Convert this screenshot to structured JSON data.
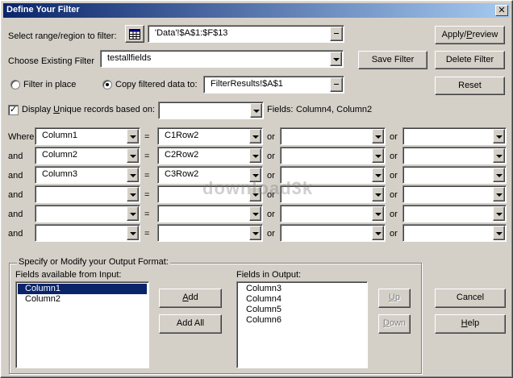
{
  "title": "Define Your Filter",
  "close_glyph": "✕",
  "select_range": {
    "label": "Select range/region to filter:",
    "value": "'Data'!$A$1:$F$13"
  },
  "existing_filter": {
    "label": "Choose Existing Filter",
    "value": "testallfields"
  },
  "filter_in_place": {
    "label": "Filter in place",
    "selected": false
  },
  "copy_to": {
    "label": "Copy filtered data to:",
    "selected": true,
    "value": "FilterResults!$A$1"
  },
  "unique": {
    "label_pre": "Display ",
    "label_u": "U",
    "label_post": "nique records based on:",
    "checked": true,
    "value": "",
    "fields_label": "Fields:",
    "fields_value": "Column4, Column2"
  },
  "buttons": {
    "apply_pre": "Apply/",
    "apply_u": "P",
    "apply_post": "review",
    "save": "Save Filter",
    "delete": "Delete Filter",
    "reset": "Reset",
    "add_u": "A",
    "add_post": "dd",
    "addall": "Add All",
    "up_u": "U",
    "up_post": "p",
    "down_u": "D",
    "down_post": "own",
    "cancel": "Cancel",
    "help_u": "H",
    "help_post": "elp"
  },
  "criteria": {
    "eq": "=",
    "or": "or",
    "rows": [
      {
        "conj": "Where",
        "field": "Column1",
        "val1": "C1Row2",
        "val2": "",
        "val3": ""
      },
      {
        "conj": "and",
        "field": "Column2",
        "val1": "C2Row2",
        "val2": "",
        "val3": ""
      },
      {
        "conj": "and",
        "field": "Column3",
        "val1": "C3Row2",
        "val2": "",
        "val3": ""
      },
      {
        "conj": "and",
        "field": "",
        "val1": "",
        "val2": "",
        "val3": ""
      },
      {
        "conj": "and",
        "field": "",
        "val1": "",
        "val2": "",
        "val3": ""
      },
      {
        "conj": "and",
        "field": "",
        "val1": "",
        "val2": "",
        "val3": ""
      }
    ]
  },
  "output": {
    "group_title": "Specify or Modify your Output Format:",
    "available_label": "Fields available from Input:",
    "available": [
      "Column1",
      "Column2"
    ],
    "available_selected": 0,
    "in_output_label": "Fields in Output:",
    "in_output": [
      "Column3",
      "Column4",
      "Column5",
      "Column6"
    ]
  },
  "watermark": "download3k",
  "icons": {
    "range_picker": "grid-icon",
    "dropdown": "chevron-down-icon",
    "browse": "browse-icon"
  }
}
